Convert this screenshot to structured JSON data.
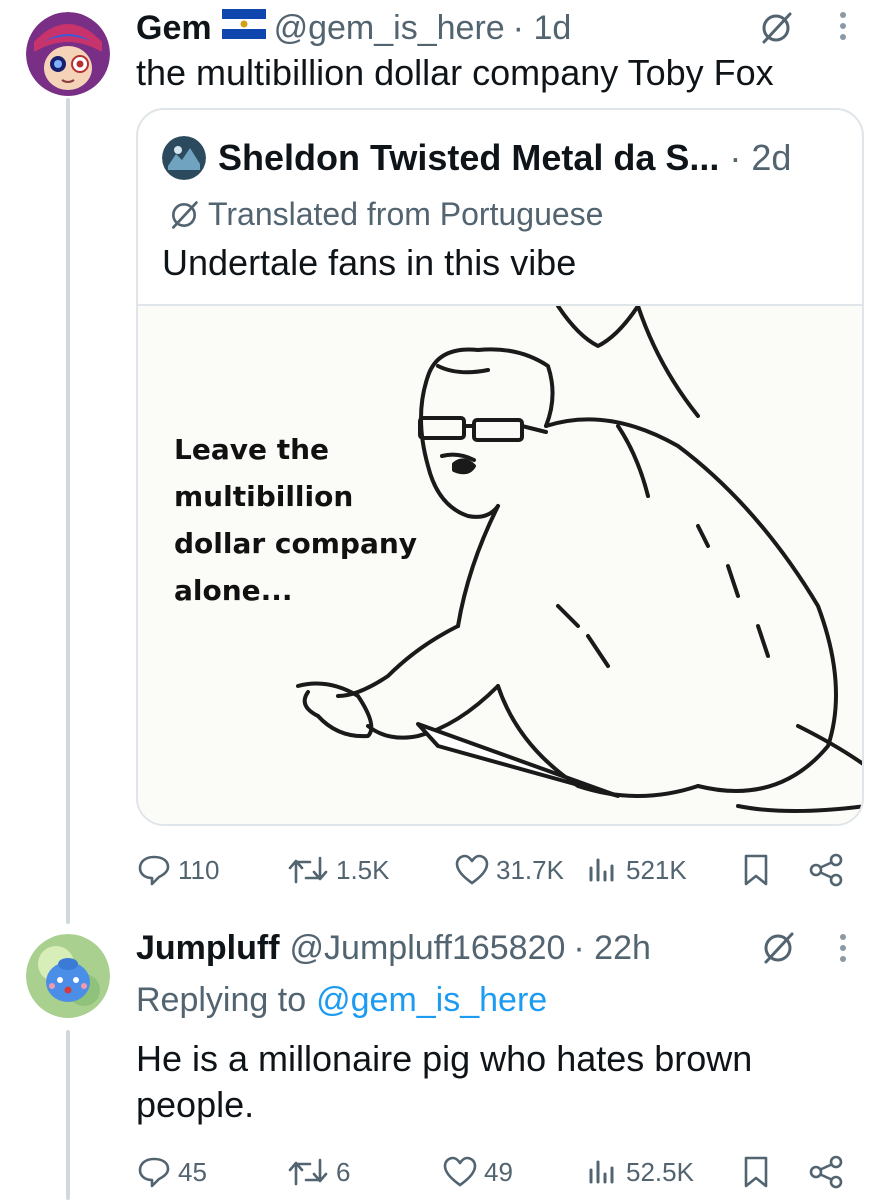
{
  "tweet": {
    "author_name": "Gem",
    "flag_icon": "el-salvador-flag-icon",
    "handle": "@gem_is_here",
    "time": "· 1d",
    "text": "the multibillion dollar company Toby Fox",
    "quote": {
      "author_name": "Sheldon Twisted Metal da S...",
      "time": "· 2d",
      "translated_label": "Translated from Portuguese",
      "text": "Undertale fans in this vibe",
      "meme_caption_lines": [
        "Leave the",
        "multibillion",
        "dollar company",
        "alone..."
      ]
    },
    "stats": {
      "replies": "110",
      "reposts": "1.5K",
      "likes": "31.7K",
      "views": "521K"
    }
  },
  "reply": {
    "author_name": "Jumpluff",
    "handle": "@Jumpluff165820",
    "time": "· 22h",
    "replying_prefix": "Replying to",
    "replying_handle": "@gem_is_here",
    "text_lines": [
      "He is a millonaire pig who hates brown",
      "people."
    ],
    "stats": {
      "replies": "45",
      "reposts": "6",
      "likes": "49",
      "views": "52.5K"
    }
  },
  "colors": {
    "text": "#0f1419",
    "muted": "#536471",
    "link": "#1d9bf0",
    "border": "#dfe5e9",
    "thread_line": "#cfd9de"
  }
}
